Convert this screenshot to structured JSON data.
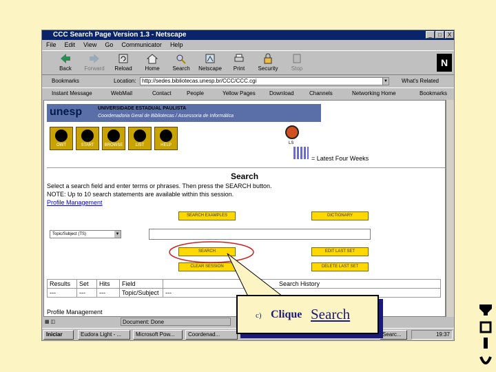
{
  "window": {
    "title": "CCC Search Page Version 1.3 - Netscape",
    "buttons": [
      "_",
      "□",
      "X"
    ]
  },
  "menu": [
    "File",
    "Edit",
    "View",
    "Go",
    "Communicator",
    "Help"
  ],
  "toolbar": [
    "Back",
    "Forward",
    "Reload",
    "Home",
    "Search",
    "Netscape",
    "Print",
    "Security",
    "Stop"
  ],
  "location": {
    "bookmarks_label": "Bookmarks",
    "location_label": "Location:",
    "url": "http://sedes.bibliotecas.unesp.br/CCC/CCC.cgi",
    "related_label": "What's Related"
  },
  "personal_bar": [
    "Instant Message",
    "WebMail",
    "Contact",
    "People",
    "Yellow Pages",
    "Download",
    "Channels",
    "Networking Home",
    "Bookmarks"
  ],
  "page": {
    "banner_logo": "unesp",
    "banner_title": "UNIVERSIDADE ESTADUAL PAULISTA",
    "banner_subtitle": "Coordenadoria Geral de Bibliotecas / Assessoria de Informática",
    "nav_buttons": [
      "OWT",
      "START",
      "BROWSE",
      "LIST",
      "HELP"
    ],
    "legend_icon_label": "LS",
    "legend_text": "= Latest Four Weeks",
    "heading": "Search",
    "instruction": "Select a search field and enter terms or phrases. Then press the SEARCH button.",
    "note": "NOTE: Up to 10 search statements are available within this session.",
    "profile_link": "Profile Management",
    "btn_examples": "SEARCH EXAMPLES",
    "btn_dictionary": "DICTIONARY",
    "field_select": "Topic/Subject (TS)",
    "search_input": "",
    "btn_search": "SEARCH",
    "btn_edit": "EDIT LAST SET",
    "btn_clear": "CLEAR SESSION",
    "btn_delete": "DELETE LAST SET",
    "table_headers": [
      "Results",
      "Set",
      "Hits",
      "Field",
      "Search History"
    ],
    "table_row": [
      "---",
      "---",
      "---",
      "Topic/Subject",
      "---"
    ],
    "profile_footer": "Profile Management"
  },
  "status": {
    "text": "Document: Done"
  },
  "taskbar": {
    "start": "Iniciar",
    "tasks": [
      "Eudora Light - ...",
      "Microsoft Pow...",
      "Coordenad..."
    ],
    "tray_task": "Searc...",
    "clock": "19:37"
  },
  "callout": {
    "prefix": "c)",
    "text": "Clique",
    "link": "Search"
  },
  "colors": {
    "slide_bg": "#fdf4c4",
    "titlebar": "#0a246a",
    "callout_shadow": "#1a1a7a",
    "web_button": "#ffd800",
    "highlight_ellipse": "#d02020"
  }
}
